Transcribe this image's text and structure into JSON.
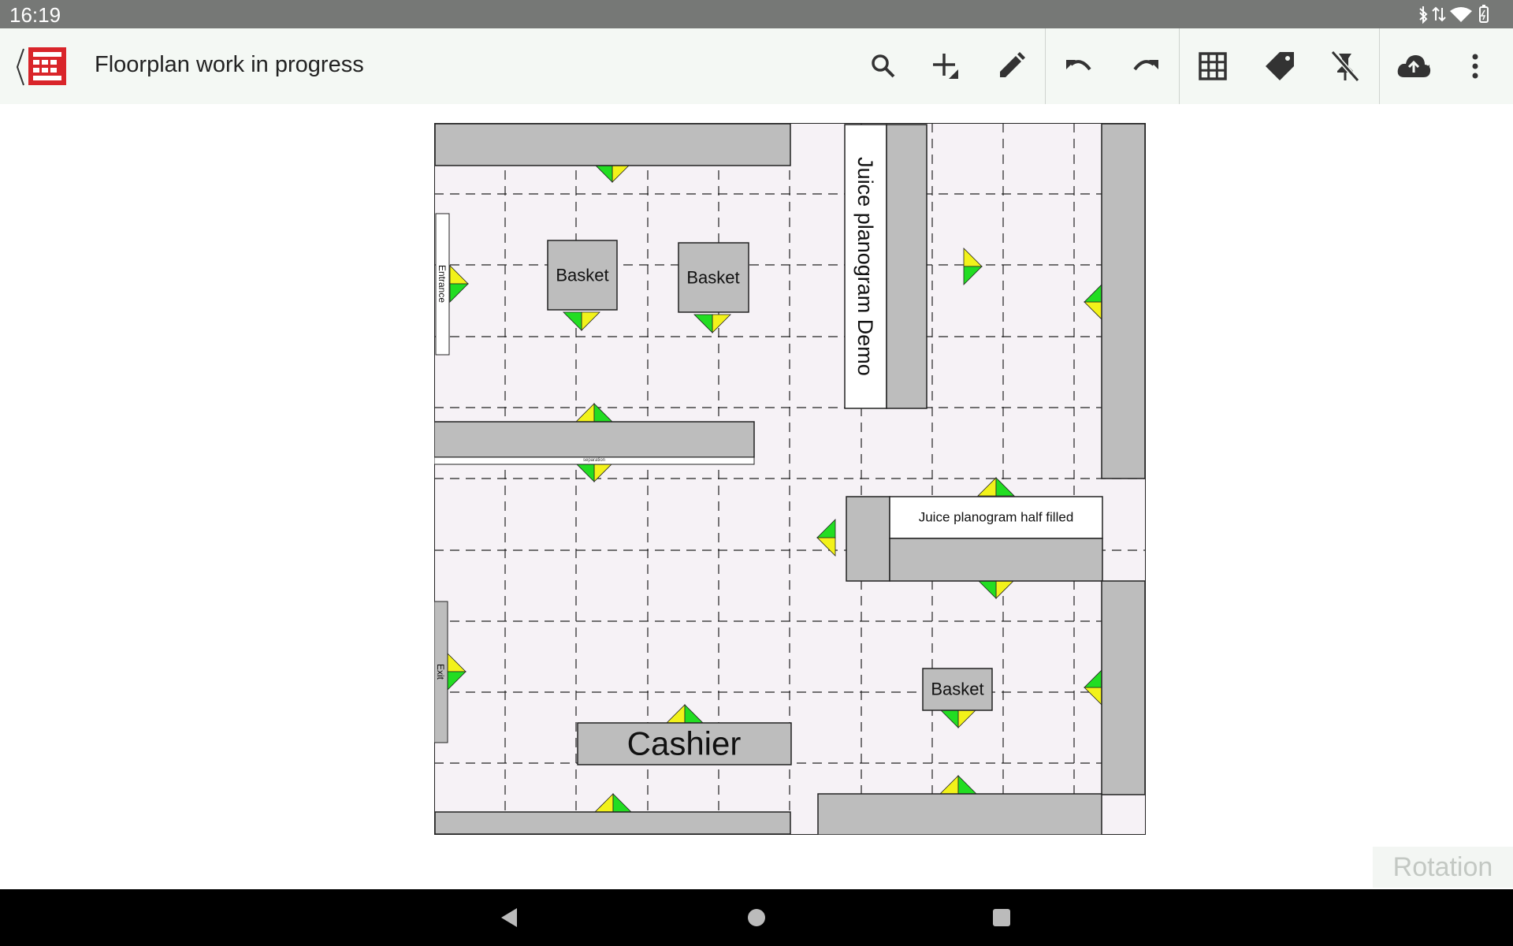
{
  "status_bar": {
    "time": "16:19"
  },
  "app_bar": {
    "title": "Floorplan work in progress",
    "actions": [
      {
        "name": "search-icon"
      },
      {
        "name": "add-element-icon"
      },
      {
        "name": "edit-icon"
      },
      {
        "name": "undo-icon"
      },
      {
        "name": "redo-icon"
      },
      {
        "name": "grid-icon"
      },
      {
        "name": "tag-icon"
      },
      {
        "name": "pin-off-icon"
      },
      {
        "name": "cloud-upload-icon"
      },
      {
        "name": "more-vert-icon"
      }
    ]
  },
  "floorplan": {
    "labels": {
      "juice_demo": "Juice planogram Demo",
      "juice_half": "Juice planogram half filled",
      "entrance": "Entrance",
      "exit": "Exit",
      "separation": "separation",
      "cashier": "Cashier",
      "basket_1": "Basket",
      "basket_2": "Basket",
      "basket_3": "Basket"
    },
    "colors": {
      "floor": "#f6f2f6",
      "shelf": "#bdbdbd",
      "marker_green": "#22dd22",
      "marker_yellow": "#f2f21a"
    }
  },
  "rotation_label": "Rotation",
  "nav_bar": {
    "back": "back-icon",
    "home": "home-icon",
    "recents": "recents-icon"
  }
}
